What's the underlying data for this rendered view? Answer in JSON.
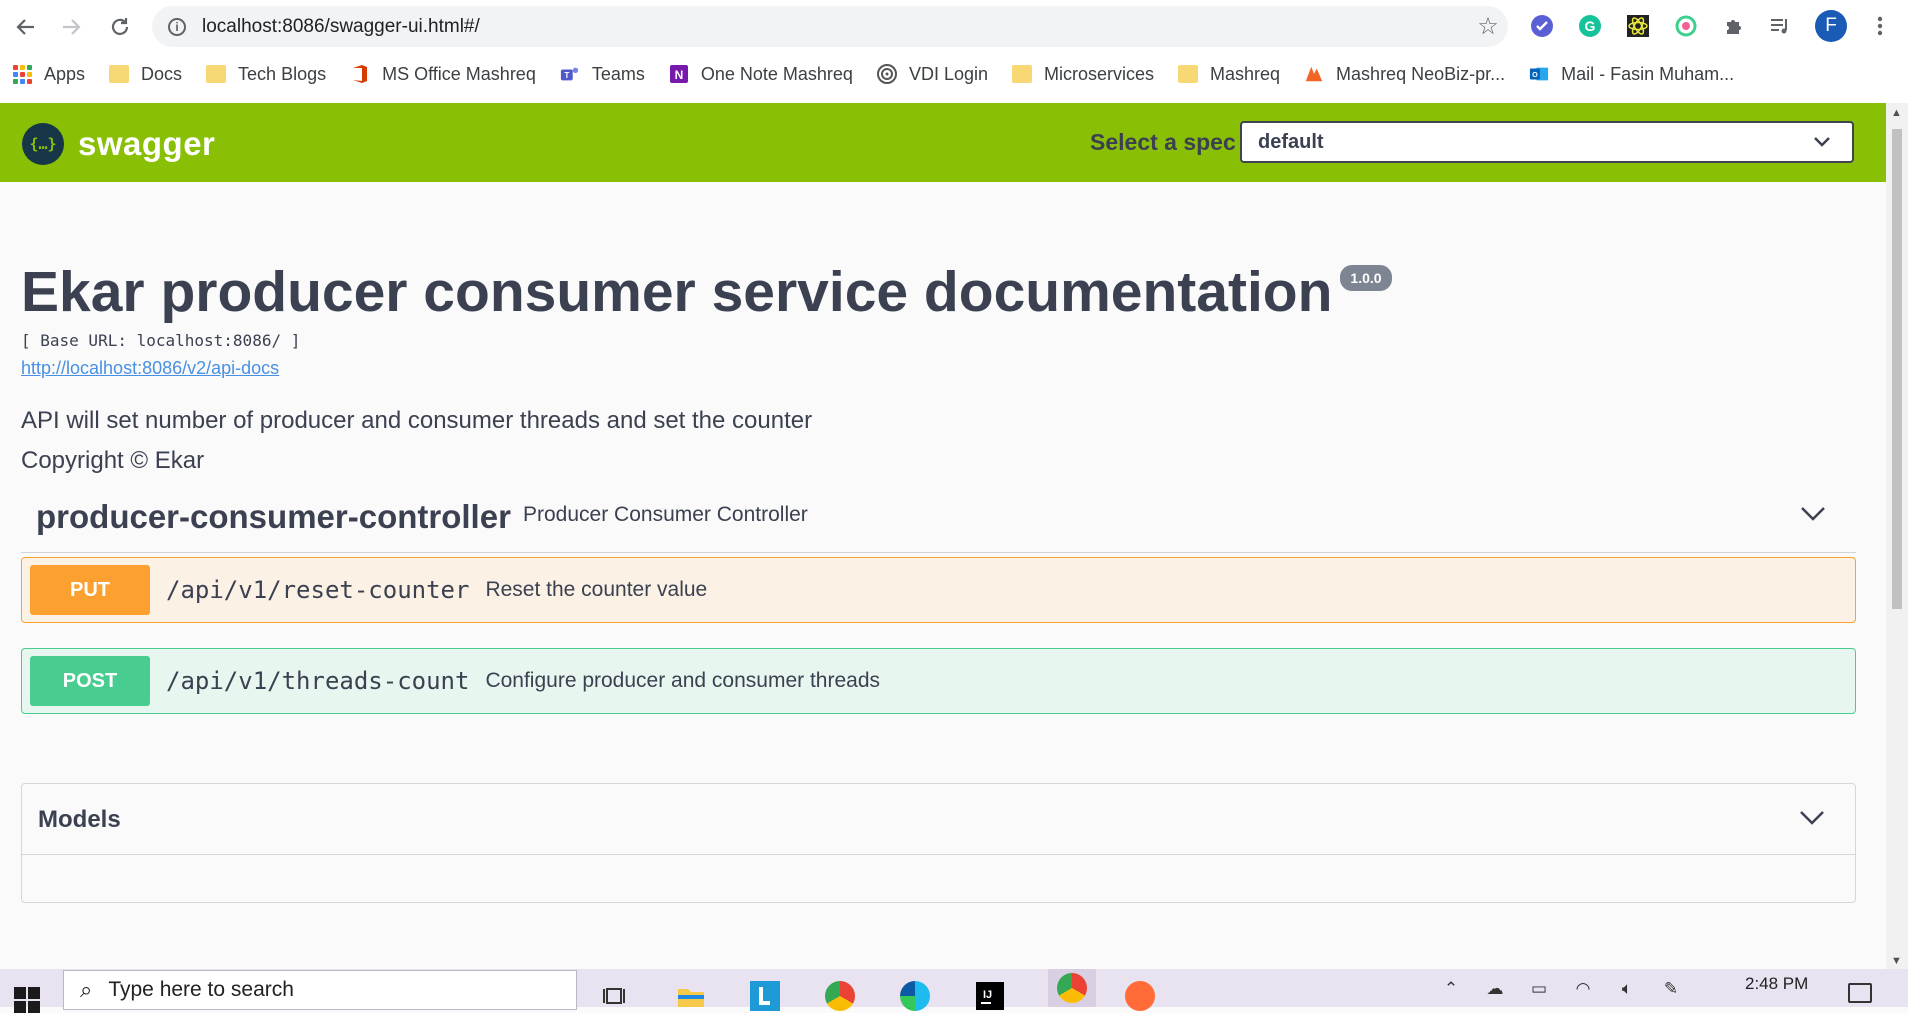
{
  "browser": {
    "url": "localhost:8086/swagger-ui.html#/",
    "profile_initial": "F",
    "bookmarks": [
      {
        "label": "Apps",
        "icon": "apps-grid-icon"
      },
      {
        "label": "Docs",
        "icon": "folder-icon"
      },
      {
        "label": "Tech Blogs",
        "icon": "folder-icon"
      },
      {
        "label": "MS Office Mashreq",
        "icon": "office-icon"
      },
      {
        "label": "Teams",
        "icon": "teams-icon"
      },
      {
        "label": "One Note Mashreq",
        "icon": "onenote-icon"
      },
      {
        "label": "VDI Login",
        "icon": "vdi-icon"
      },
      {
        "label": "Microservices",
        "icon": "folder-icon"
      },
      {
        "label": "Mashreq",
        "icon": "folder-icon"
      },
      {
        "label": "Mashreq NeoBiz-pr...",
        "icon": "mashreq-icon"
      },
      {
        "label": "Mail - Fasin Muham...",
        "icon": "outlook-icon"
      }
    ]
  },
  "swagger": {
    "logo_text": "swagger",
    "spec_label": "Select a spec",
    "spec_value": "default",
    "title": "Ekar producer consumer service documentation",
    "version": "1.0.0",
    "base_url": "[ Base URL: localhost:8086/ ]",
    "api_docs_link": "http://localhost:8086/v2/api-docs",
    "description": "API will set number of producer and consumer threads and set the counter",
    "copyright": "Copyright © Ekar",
    "tag": {
      "name": "producer-consumer-controller",
      "description": "Producer Consumer Controller"
    },
    "operations": [
      {
        "method": "PUT",
        "path": "/api/v1/reset-counter",
        "summary": "Reset the counter value"
      },
      {
        "method": "POST",
        "path": "/api/v1/threads-count",
        "summary": "Configure producer and consumer threads"
      }
    ],
    "models_title": "Models"
  },
  "taskbar": {
    "search_placeholder": "Type here to search",
    "time": "2:48 PM"
  },
  "colors": {
    "swagger_green": "#89bf04",
    "put": "#fca130",
    "post": "#49cc90",
    "text": "#3b4151",
    "link": "#4990e2"
  }
}
